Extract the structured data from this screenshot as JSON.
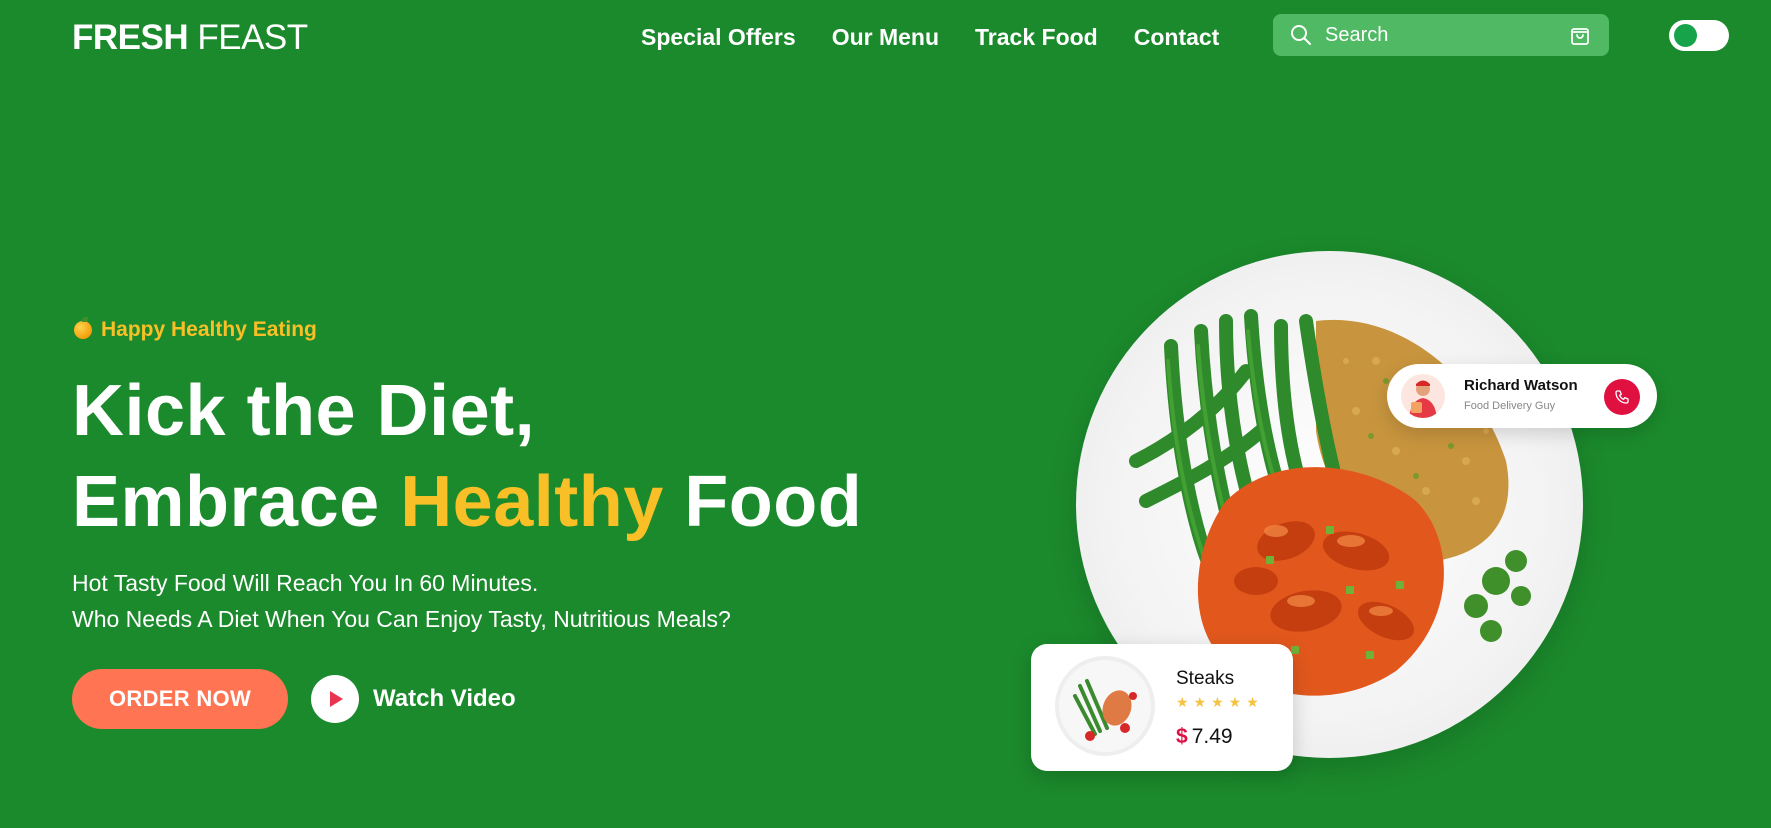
{
  "brand": {
    "name_bold": "FRESH",
    "name_light": "FEAST"
  },
  "nav": {
    "items": [
      {
        "label": "Special Offers"
      },
      {
        "label": "Our Menu"
      },
      {
        "label": "Track Food"
      },
      {
        "label": "Contact"
      }
    ]
  },
  "search": {
    "placeholder": "Search",
    "search_icon": "search-icon",
    "cart_icon": "shopping-bag-icon"
  },
  "theme_toggle": {
    "state": "off",
    "knob_color": "#16a34a"
  },
  "hero": {
    "tagline": "Happy Healthy Eating",
    "headline_line1": "Kick the Diet,",
    "headline_line2_start": "Embrace",
    "headline_line2_accent": "Healthy",
    "headline_line2_end": "Food",
    "subtext_line1": "Hot Tasty Food Will Reach You In 60 Minutes.",
    "subtext_line2": "Who Needs A Diet When You Can Enjoy Tasty, Nutritious Meals?",
    "order_button": "ORDER NOW",
    "watch_video": "Watch Video"
  },
  "delivery_card": {
    "name": "Richard Watson",
    "role": "Food Delivery Guy",
    "call_icon": "phone-icon"
  },
  "dish_card": {
    "name": "Steaks",
    "stars": "★★★★★",
    "rating": 5,
    "currency": "$",
    "price": "7.49"
  },
  "colors": {
    "background": "#1b8a2c",
    "accent_yellow": "#f8c026",
    "order_button": "#ff7452",
    "call_button": "#e01040",
    "search_bg": "#4fba63"
  }
}
